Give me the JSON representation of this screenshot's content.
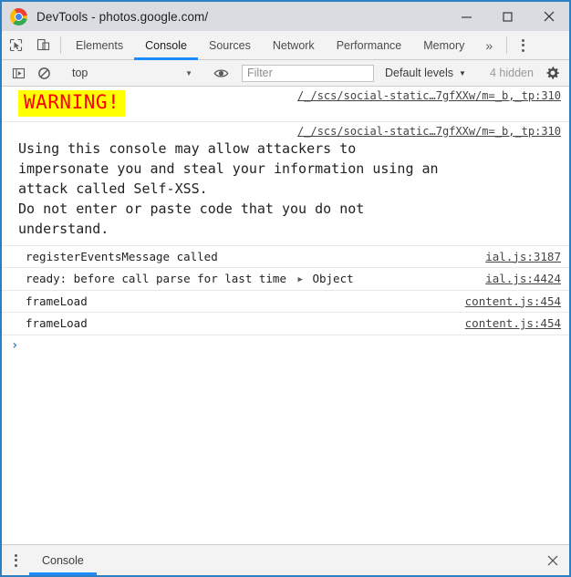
{
  "window": {
    "title": "DevTools - photos.google.com/",
    "logo_icon": "chrome-logo-icon",
    "minimize_label": "—",
    "maximize_label": "□",
    "close_label": "✕"
  },
  "tabstrip": {
    "inspect_icon": "inspect-element-icon",
    "device_icon": "device-toolbar-icon",
    "tabs": [
      {
        "label": "Elements",
        "active": false
      },
      {
        "label": "Console",
        "active": true
      },
      {
        "label": "Sources",
        "active": false
      },
      {
        "label": "Network",
        "active": false
      },
      {
        "label": "Performance",
        "active": false
      },
      {
        "label": "Memory",
        "active": false
      }
    ],
    "overflow_label": "»",
    "menu_icon": "more-vertical-icon"
  },
  "console_toolbar": {
    "sidebar_icon": "console-sidebar-icon",
    "clear_icon": "clear-console-icon",
    "context": "top",
    "context_caret": "▼",
    "eye_icon": "live-expression-eye-icon",
    "filter_placeholder": "Filter",
    "filter_value": "",
    "levels_label": "Default levels",
    "levels_caret": "▼",
    "hidden_label": "4 hidden",
    "settings_icon": "settings-gear-icon"
  },
  "console": {
    "messages": [
      {
        "kind": "warning-badge",
        "text": "WARNING!",
        "source": "/_/scs/social-static…7gfXXw/m=_b,_tp:310",
        "bg_color": "#ffff00",
        "text_color": "#ff0000"
      },
      {
        "kind": "warning-body",
        "text": "Using this console may allow attackers to\nimpersonate you and steal your information using an\nattack called Self-XSS.\nDo not enter or paste code that you do not\nunderstand.",
        "source": "/_/scs/social-static…7gfXXw/m=_b,_tp:310"
      },
      {
        "kind": "log",
        "text": "registerEventsMessage called",
        "object": "",
        "disclosure": "",
        "source": "ial.js:3187"
      },
      {
        "kind": "log",
        "text": "ready: before call parse for last time",
        "object": "Object",
        "disclosure": "▶",
        "source": "ial.js:4424"
      },
      {
        "kind": "log",
        "text": "frameLoad",
        "object": "",
        "disclosure": "",
        "source": "content.js:454"
      },
      {
        "kind": "log",
        "text": "frameLoad",
        "object": "",
        "disclosure": "",
        "source": "content.js:454"
      }
    ],
    "prompt_caret": "›"
  },
  "drawer": {
    "menu_icon": "more-vertical-icon",
    "tab_label": "Console",
    "close_label": "✕"
  },
  "colors": {
    "accent_blue": "#1a8cff",
    "window_border": "#2d7fc1",
    "titlebar_bg": "#d9dde1",
    "toolbar_bg": "#f3f3f3",
    "warning_bg": "#ffff00",
    "warning_fg": "#ff0000",
    "prompt_blue": "#3b78c4"
  }
}
